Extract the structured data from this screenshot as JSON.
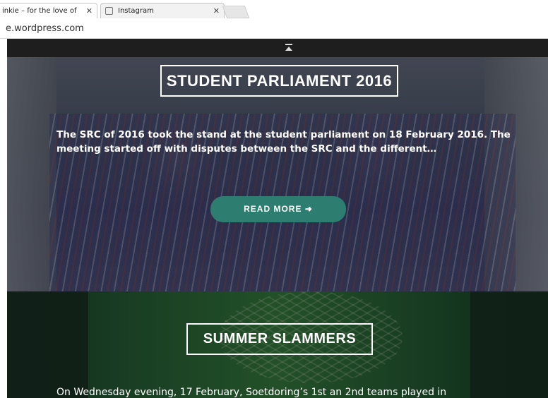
{
  "browser": {
    "tabs": [
      {
        "title": "inkie – for the love of",
        "close": "✕"
      },
      {
        "title": "Instagram",
        "close": "✕"
      }
    ],
    "url": "e.wordpress.com"
  },
  "posts": [
    {
      "title": "STUDENT PARLIAMENT 2016",
      "excerpt": "The SRC of 2016 took the stand at the student parliament on 18 February 2016. The meeting started off with disputes between the SRC and the different…",
      "read_more": "READ MORE ➜"
    },
    {
      "title": "SUMMER SLAMMERS",
      "excerpt": "On Wednesday evening, 17 February, Soetdoring’s 1st an 2nd teams played in"
    }
  ],
  "colors": {
    "read_more_button": "#2d7d70",
    "top_strip": "#1e1e1e"
  },
  "icons": {
    "scroll_top": "scroll-to-top-icon",
    "favicon": "instagram-favicon-icon"
  }
}
